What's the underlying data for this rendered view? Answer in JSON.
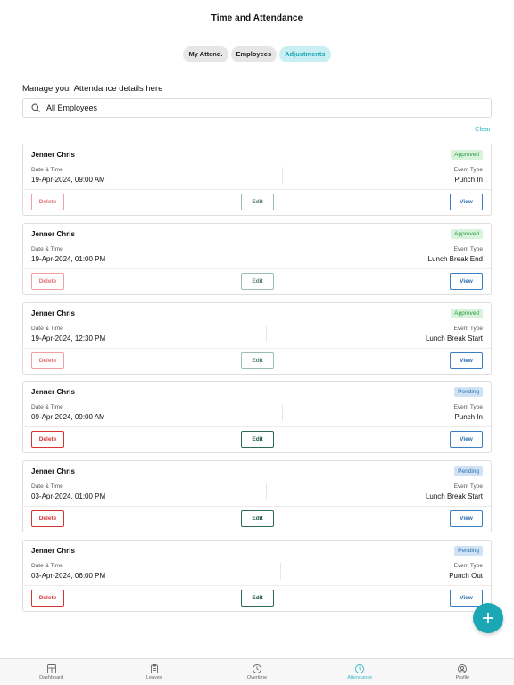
{
  "header": {
    "title": "Time and Attendance"
  },
  "tabs": [
    {
      "label": "My Attend.",
      "active": false
    },
    {
      "label": "Employees",
      "active": false
    },
    {
      "label": "Adjustments",
      "active": true
    }
  ],
  "manage_text": "Manage your Attendance details here",
  "search": {
    "value": "All Employees",
    "icon": "search-icon"
  },
  "clear_label": "Clear",
  "labels": {
    "date_time": "Date & Time",
    "event_type": "Event Type",
    "delete": "Delete",
    "edit": "Edit",
    "view": "View"
  },
  "records": [
    {
      "name": "Jenner Chris",
      "status": "Approved",
      "date_time": "19-Apr-2024, 09:00 AM",
      "event_type": "Punch In"
    },
    {
      "name": "Jenner Chris",
      "status": "Approved",
      "date_time": "19-Apr-2024, 01:00 PM",
      "event_type": "Lunch Break End"
    },
    {
      "name": "Jenner Chris",
      "status": "Approved",
      "date_time": "19-Apr-2024, 12:30 PM",
      "event_type": "Lunch Break Start"
    },
    {
      "name": "Jenner Chris",
      "status": "Pending",
      "date_time": "09-Apr-2024, 09:00 AM",
      "event_type": "Punch In"
    },
    {
      "name": "Jenner Chris",
      "status": "Pending",
      "date_time": "03-Apr-2024, 01:00 PM",
      "event_type": "Lunch Break Start"
    },
    {
      "name": "Jenner Chris",
      "status": "Pending",
      "date_time": "03-Apr-2024, 06:00 PM",
      "event_type": "Punch Out"
    }
  ],
  "bottom_nav": [
    {
      "label": "Dashboard",
      "icon": "dashboard-icon",
      "active": false
    },
    {
      "label": "Leaves",
      "icon": "clipboard-icon",
      "active": false
    },
    {
      "label": "Overtime",
      "icon": "clock-icon",
      "active": false
    },
    {
      "label": "Attendance",
      "icon": "clock-icon",
      "active": true
    },
    {
      "label": "Profile",
      "icon": "profile-icon",
      "active": false
    }
  ],
  "colors": {
    "accent": "#1ba7b3",
    "approved_bg": "#d8f3dc",
    "pending_bg": "#cfe3f5",
    "delete": "#d63333",
    "view": "#2b6fb0"
  }
}
